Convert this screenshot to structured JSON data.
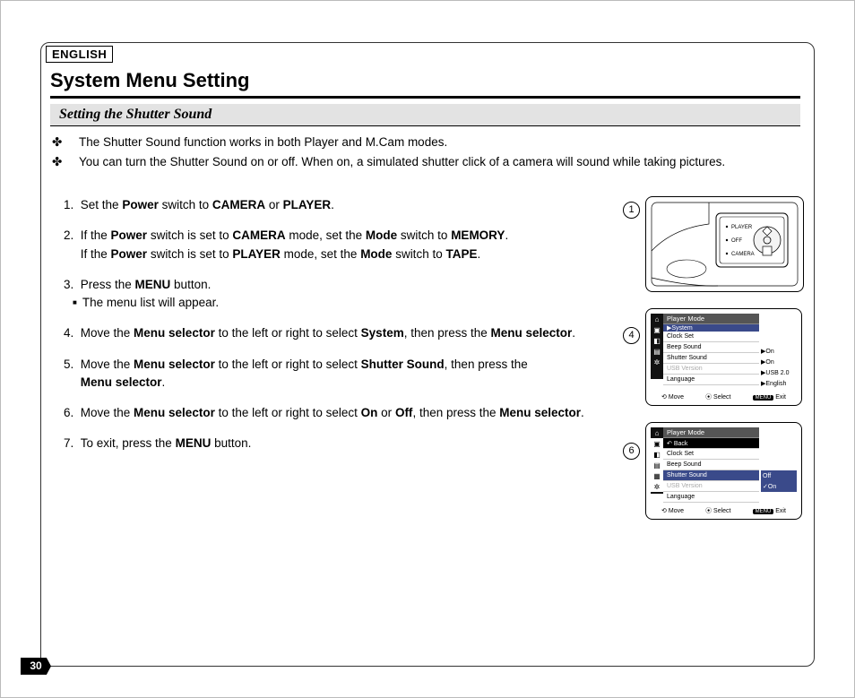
{
  "language_box": "ENGLISH",
  "title": "System Menu Setting",
  "subtitle": "Setting the Shutter Sound",
  "intro": [
    "The Shutter Sound function works in both Player and M.Cam modes.",
    "You can turn the Shutter Sound on or off. When on, a simulated shutter click of a camera will sound while taking pictures."
  ],
  "steps": {
    "s1_a": "Set the ",
    "s1_b": "Power",
    "s1_c": " switch to ",
    "s1_d": "CAMERA",
    "s1_e": " or ",
    "s1_f": "PLAYER",
    "s1_g": ".",
    "s2_a": "If the ",
    "s2_b": "Power",
    "s2_c": " switch is set to ",
    "s2_d": "CAMERA",
    "s2_e": " mode, set the ",
    "s2_f": "Mode",
    "s2_g": " switch to ",
    "s2_h": "MEMORY",
    "s2_i": ".",
    "s2_j": "If the ",
    "s2_k": "Power",
    "s2_l": " switch is set to ",
    "s2_m": "PLAYER",
    "s2_n": " mode, set the ",
    "s2_o": "Mode",
    "s2_p": " switch to ",
    "s2_q": "TAPE",
    "s2_r": ".",
    "s3_a": "Press the ",
    "s3_b": "MENU",
    "s3_c": " button.",
    "s3_sub": "The menu list will appear.",
    "s4_a": "Move the ",
    "s4_b": "Menu selector",
    "s4_c": " to the left or right to select ",
    "s4_d": "System",
    "s4_e": ", then press the ",
    "s4_f": "Menu selector",
    "s4_g": ".",
    "s5_a": "Move the ",
    "s5_b": "Menu selector",
    "s5_c": " to the left or right to select ",
    "s5_d": "Shutter Sound",
    "s5_e": ", then press the",
    "s5_f": "Menu selector",
    "s5_g": ".",
    "s6_a": "Move the ",
    "s6_b": "Menu selector",
    "s6_c": " to the left or right to select ",
    "s6_d": "On",
    "s6_e": " or ",
    "s6_f": "Off",
    "s6_g": ", then press the ",
    "s6_h": "Menu selector",
    "s6_i": ".",
    "s7_a": "To exit, press the ",
    "s7_b": "MENU",
    "s7_c": " button."
  },
  "fig_labels": {
    "one": "1",
    "four": "4",
    "six": "6"
  },
  "fig1": {
    "opt_player": "PLAYER",
    "opt_off": "OFF",
    "opt_camera": "CAMERA"
  },
  "menu4": {
    "title": "Player Mode",
    "highlight": "System",
    "items": [
      "Clock Set",
      "Beep Sound",
      "Shutter Sound",
      "USB Version",
      "Language"
    ],
    "vals": [
      "",
      "On",
      "On",
      "USB 2.0",
      "English"
    ],
    "footer": {
      "move": "Move",
      "select": "Select",
      "exit": "Exit",
      "menu": "MENU"
    }
  },
  "menu6": {
    "title": "Player Mode",
    "back": "Back",
    "items": [
      "Clock Set",
      "Beep Sound",
      "Shutter Sound",
      "USB Version",
      "Language"
    ],
    "opt_off": "Off",
    "opt_on": "On",
    "footer": {
      "move": "Move",
      "select": "Select",
      "exit": "Exit",
      "menu": "MENU"
    }
  },
  "page_number": "30"
}
